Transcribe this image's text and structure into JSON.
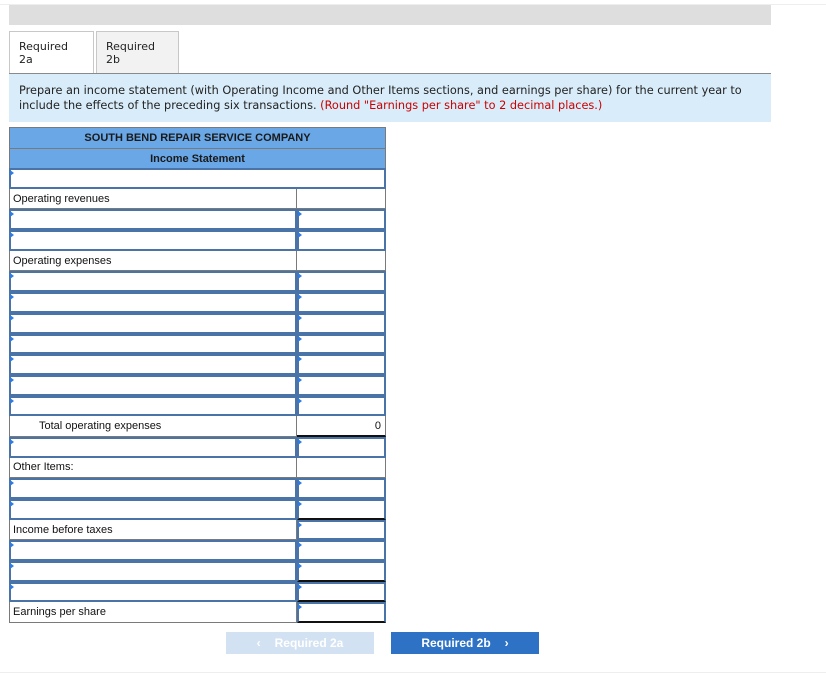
{
  "tabs": [
    {
      "label": "Required 2a",
      "active": true
    },
    {
      "label": "Required 2b",
      "active": false
    }
  ],
  "instructions": {
    "text": "Prepare an income statement (with Operating Income and Other Items sections, and earnings per share) for the current year to include the effects of the preceding six transactions.",
    "note": "(Round \"Earnings per share\" to 2 decimal places.)"
  },
  "statement": {
    "company": "SOUTH BEND REPAIR SERVICE COMPANY",
    "title": "Income Statement",
    "labels": {
      "operating_revenues": "Operating revenues",
      "operating_expenses": "Operating expenses",
      "total_operating_expenses": "Total operating expenses",
      "other_items": "Other Items:",
      "income_before_taxes": "Income before taxes",
      "earnings_per_share": "Earnings per share"
    },
    "values": {
      "total_operating_expenses": "0"
    }
  },
  "nav": {
    "prev_label": "Required 2a",
    "next_label": "Required 2b",
    "prev_icon": "‹",
    "next_icon": "›"
  }
}
